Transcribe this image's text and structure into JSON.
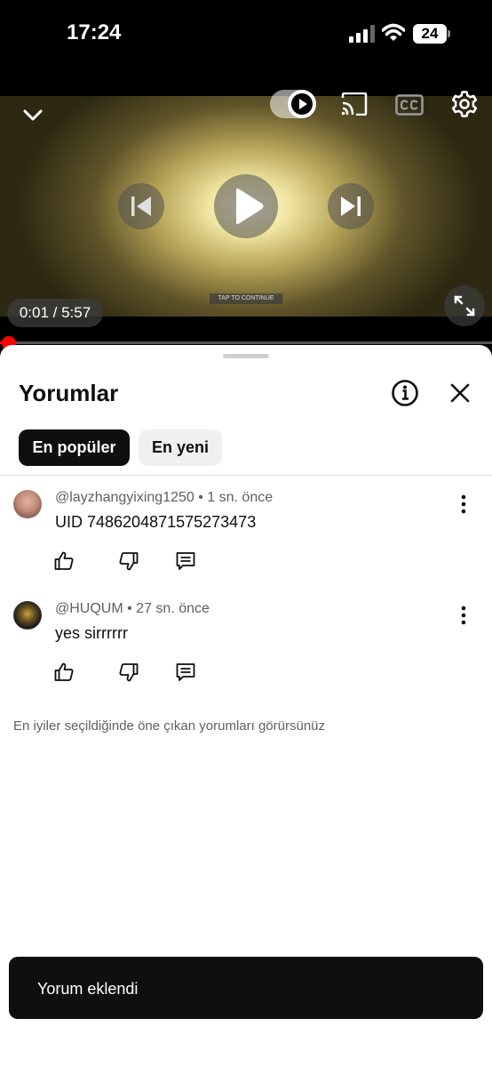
{
  "status_bar": {
    "time": "17:24",
    "battery": "24",
    "icons": [
      "signal-icon",
      "wifi-icon",
      "battery-icon"
    ]
  },
  "player": {
    "current_time": "0:01",
    "duration": "5:57",
    "time_display": "0:01 / 5:57",
    "overlay_text": "TAP TO CONTINUE",
    "progress_fraction": 0.003,
    "autoplay_on": true,
    "icons": [
      "chevron-down-icon",
      "autoplay-toggle",
      "cast-icon",
      "cc-icon",
      "settings-icon",
      "previous-icon",
      "play-icon",
      "next-icon",
      "fullscreen-icon"
    ]
  },
  "comments_panel": {
    "title": "Yorumlar",
    "icons": [
      "info-icon",
      "close-icon"
    ],
    "tabs": [
      {
        "label": "En popüler",
        "selected": true
      },
      {
        "label": "En yeni",
        "selected": false
      }
    ],
    "comments": [
      {
        "author": "@layzhangyixing1250",
        "time": "1 sn. önce",
        "meta": "@layzhangyixing1250 • 1 sn. önce",
        "text": "UID 7486204871575273473"
      },
      {
        "author": "@HUQUM",
        "time": "27 sn. önce",
        "meta": "@HUQUM • 27 sn. önce",
        "text": "yes sirrrrrr"
      }
    ],
    "footnote": "En iyiler seçildiğinde öne çıkan yorumları görürsünüz"
  },
  "toast": {
    "message": "Yorum eklendi"
  },
  "colors": {
    "accent_red": "#ff0000",
    "chip_selected_bg": "#0f0f0f",
    "chip_bg": "#f0f0f0",
    "toast_bg": "#0f0f0f"
  }
}
